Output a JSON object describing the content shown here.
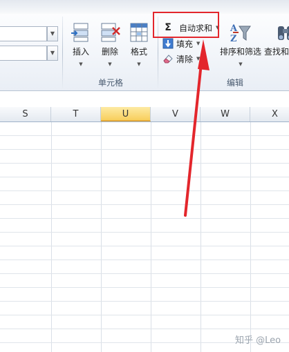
{
  "ribbon": {
    "cells_group": {
      "label": "单元格",
      "insert_label": "插入",
      "delete_label": "删除",
      "format_label": "格式"
    },
    "editing_group": {
      "label": "编辑",
      "autosum_symbol": "Σ",
      "autosum_label": "自动求和",
      "fill_label": "填充",
      "clear_label": "清除",
      "sort_filter_label": "排序和筛选",
      "find_select_label": "查找和"
    },
    "combo_dropdown_symbol": "▼"
  },
  "grid": {
    "columns": [
      "S",
      "T",
      "U",
      "V",
      "W",
      "X"
    ],
    "active_column": "U",
    "active_color": "#f8cf5d"
  },
  "annotation": {
    "highlight_color": "#e3262c"
  },
  "watermark": "知乎 @Leo",
  "icons": [
    "insert-cells-icon",
    "delete-cells-icon",
    "format-cells-icon",
    "sigma-icon",
    "fill-down-icon",
    "eraser-icon",
    "sort-filter-icon",
    "binoculars-icon",
    "dropdown-caret-icon"
  ]
}
